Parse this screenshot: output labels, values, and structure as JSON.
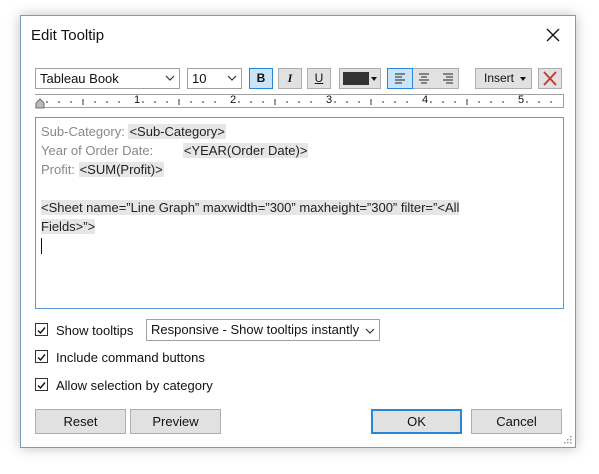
{
  "dialog": {
    "title": "Edit Tooltip"
  },
  "toolbar": {
    "font_family": "Tableau Book",
    "font_size": "10",
    "bold_label": "B",
    "italic_label": "I",
    "underline_label": "U",
    "text_color": "#333333",
    "insert_label": "Insert",
    "active_alignment": "left"
  },
  "ruler": {
    "marks": [
      "1",
      "2",
      "3",
      "4",
      "5"
    ]
  },
  "editor": {
    "line1_label": "Sub-Category:",
    "line1_field": "<Sub-Category>",
    "line2_label": "Year of Order Date:",
    "line2_field": "<YEAR(Order Date)>",
    "line3_label": "Profit:",
    "line3_field": "<SUM(Profit)>",
    "sheet_line1": "<Sheet name=”Line Graph” maxwidth=”300” maxheight=”300” filter=”<All",
    "sheet_line2": "Fields>”>"
  },
  "options": {
    "show_tooltips": {
      "label": "Show tooltips",
      "checked": true
    },
    "tooltip_mode": "Responsive - Show tooltips instantly",
    "include_command_buttons": {
      "label": "Include command buttons",
      "checked": true
    },
    "allow_selection": {
      "label": "Allow selection by category",
      "checked": true
    }
  },
  "buttons": {
    "reset": "Reset",
    "preview": "Preview",
    "ok": "OK",
    "cancel": "Cancel"
  }
}
